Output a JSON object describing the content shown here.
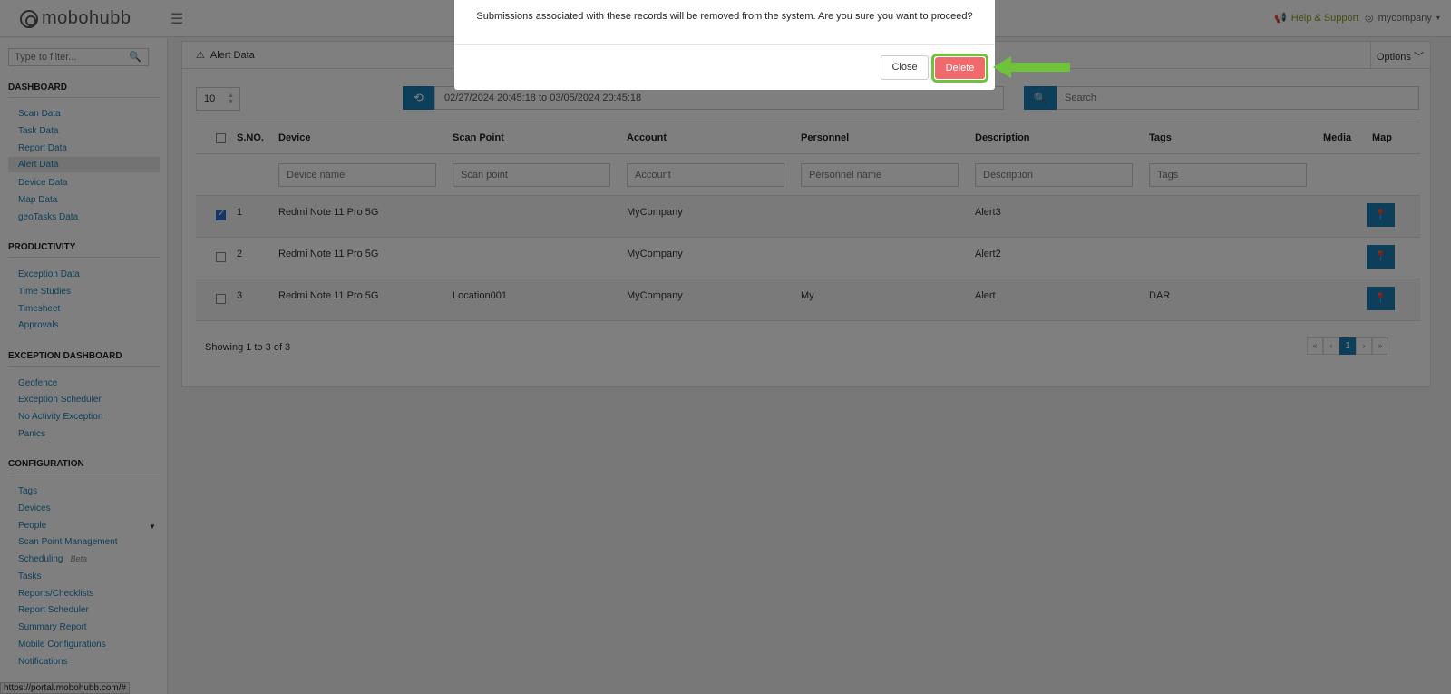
{
  "app": {
    "logo_text": "mobohubb",
    "help_label": "Help & Support",
    "user_label": "mycompany"
  },
  "sidebar": {
    "filter_placeholder": "Type to filter...",
    "sections": [
      {
        "title": "DASHBOARD",
        "items": [
          "Scan Data",
          "Task Data",
          "Report Data",
          "Alert Data",
          "Device Data",
          "Map Data",
          "geoTasks Data"
        ]
      },
      {
        "title": "PRODUCTIVITY",
        "items": [
          "Exception Data",
          "Time Studies",
          "Timesheet",
          "Approvals"
        ]
      },
      {
        "title": "EXCEPTION DASHBOARD",
        "items": [
          "Geofence",
          "Exception Scheduler",
          "No Activity Exception",
          "Panics"
        ]
      },
      {
        "title": "CONFIGURATION",
        "items": [
          "Tags",
          "Devices",
          "People",
          "Scan Point Management",
          "Scheduling",
          "Tasks",
          "Reports/Checklists",
          "Report Scheduler",
          "Summary Report",
          "Mobile Configurations",
          "Notifications"
        ]
      }
    ],
    "active_item": "Alert Data",
    "beta_label": "Beta"
  },
  "panel": {
    "title": "Alert Data",
    "options_label": "Options",
    "per_page": "10",
    "date_range": "02/27/2024 20:45:18 to 03/05/2024 20:45:18",
    "search_placeholder": "Search",
    "columns": [
      "S.NO.",
      "Device",
      "Scan Point",
      "Account",
      "Personnel",
      "Description",
      "Tags",
      "Media",
      "Map"
    ],
    "filter_placeholders": [
      "Device name",
      "Scan point",
      "Account",
      "Personnel name",
      "Description",
      "Tags"
    ],
    "rows": [
      {
        "sno": "1",
        "device": "Redmi Note 11 Pro 5G",
        "scan_point": "",
        "account": "MyCompany",
        "personnel": "",
        "description": "Alert3",
        "tags": "",
        "checked": true
      },
      {
        "sno": "2",
        "device": "Redmi Note 11 Pro 5G",
        "scan_point": "",
        "account": "MyCompany",
        "personnel": "",
        "description": "Alert2",
        "tags": "",
        "checked": false
      },
      {
        "sno": "3",
        "device": "Redmi Note 11 Pro 5G",
        "scan_point": "Location001",
        "account": "MyCompany",
        "personnel": "My",
        "description": "Alert",
        "tags": "DAR",
        "checked": false
      }
    ],
    "showing": "Showing 1 to 3 of 3",
    "pager": [
      "«",
      "‹",
      "1",
      "›",
      "»"
    ],
    "current_page": "1"
  },
  "status_url": "https://portal.mobohubb.com/#",
  "modal": {
    "message": "Submissions associated with these records will be removed from the system. Are you sure you want to proceed?",
    "close_label": "Close",
    "delete_label": "Delete"
  },
  "colors": {
    "accent": "#1d7fb5",
    "delete": "#f06a6d",
    "highlight": "#6fc33a",
    "help": "#8a9b1e"
  }
}
